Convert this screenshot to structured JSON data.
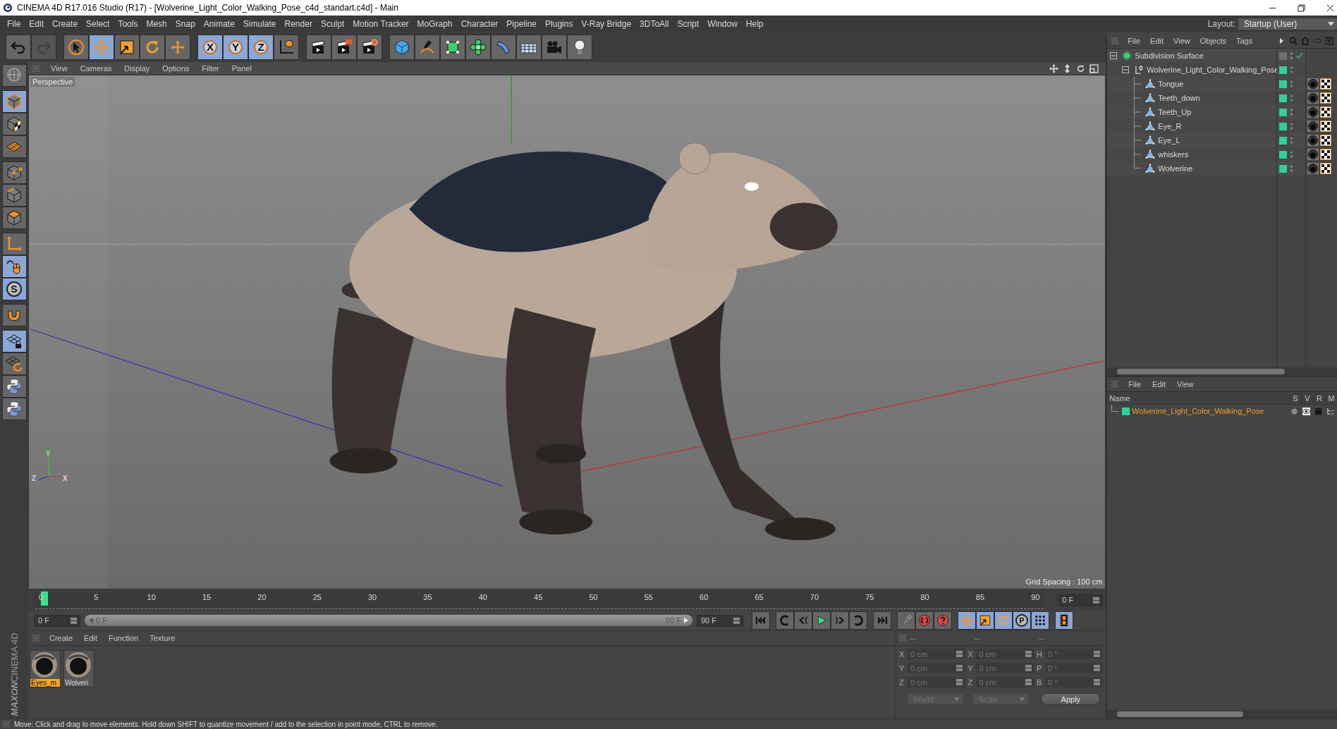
{
  "window": {
    "title": "CINEMA 4D R17.016 Studio (R17) - [Wolverine_Light_Color_Walking_Pose_c4d_standart.c4d] - Main"
  },
  "menu": [
    "File",
    "Edit",
    "Create",
    "Select",
    "Tools",
    "Mesh",
    "Snap",
    "Animate",
    "Simulate",
    "Render",
    "Sculpt",
    "Motion Tracker",
    "MoGraph",
    "Character",
    "Pipeline",
    "Plugins",
    "V-Ray Bridge",
    "3DToAll",
    "Script",
    "Window",
    "Help"
  ],
  "layout": {
    "label": "Layout:",
    "value": "Startup (User)"
  },
  "toolbar_groups": [
    [
      {
        "kind": "undo",
        "selected": false,
        "disabled": false
      },
      {
        "kind": "redo",
        "selected": false,
        "disabled": true
      }
    ],
    [
      {
        "kind": "select",
        "selected": false,
        "disabled": false
      },
      {
        "kind": "move",
        "selected": true,
        "disabled": false
      },
      {
        "kind": "scale",
        "selected": false,
        "disabled": false
      },
      {
        "kind": "rotate",
        "selected": false,
        "disabled": false
      },
      {
        "kind": "transform",
        "selected": false,
        "disabled": false
      }
    ],
    [
      {
        "kind": "axis",
        "label": "X",
        "selected": true,
        "disabled": false
      },
      {
        "kind": "axis",
        "label": "Y",
        "selected": true,
        "disabled": false
      },
      {
        "kind": "axis",
        "label": "Z",
        "selected": true,
        "disabled": false
      },
      {
        "kind": "coords",
        "selected": false,
        "disabled": false
      }
    ],
    [
      {
        "kind": "render_view",
        "selected": false,
        "disabled": false
      },
      {
        "kind": "render_picture",
        "selected": false,
        "disabled": false
      },
      {
        "kind": "render_settings",
        "selected": false,
        "disabled": false
      }
    ],
    [
      {
        "kind": "cube",
        "selected": false,
        "disabled": false
      },
      {
        "kind": "pen",
        "selected": false,
        "disabled": false
      },
      {
        "kind": "subdivision",
        "selected": false,
        "disabled": false
      },
      {
        "kind": "cloner",
        "selected": false,
        "disabled": false
      },
      {
        "kind": "deformer",
        "selected": false,
        "disabled": false
      },
      {
        "kind": "floor",
        "selected": false,
        "disabled": false
      },
      {
        "kind": "camera",
        "selected": false,
        "disabled": false
      },
      {
        "kind": "light",
        "selected": false,
        "disabled": false
      }
    ]
  ],
  "left_toolbar_groups": [
    [
      {
        "kind": "globe",
        "selected": false
      }
    ],
    [
      {
        "kind": "model",
        "selected": true
      },
      {
        "kind": "texture",
        "selected": false
      },
      {
        "kind": "workplane",
        "selected": false
      }
    ],
    [
      {
        "kind": "points",
        "selected": false
      },
      {
        "kind": "edges",
        "selected": false
      },
      {
        "kind": "polygons",
        "selected": false
      }
    ],
    [
      {
        "kind": "axis_mode",
        "selected": false
      },
      {
        "kind": "mouse",
        "selected": true
      },
      {
        "kind": "solo",
        "label": "S",
        "selected": true
      }
    ],
    [
      {
        "kind": "magnet",
        "selected": false
      }
    ],
    [
      {
        "kind": "grid_lock",
        "selected": true
      },
      {
        "kind": "grid_refresh",
        "selected": false
      },
      {
        "kind": "python",
        "selected": false
      },
      {
        "kind": "python",
        "selected": false
      }
    ]
  ],
  "viewport": {
    "menu": [
      "View",
      "Cameras",
      "Display",
      "Options",
      "Filter",
      "Panel"
    ],
    "camera_label": "Perspective",
    "grid_spacing": "Grid Spacing : 100 cm",
    "axis_labels": [
      "Y",
      "Z",
      "X"
    ]
  },
  "timeline": {
    "ticks": [
      "0",
      "5",
      "10",
      "15",
      "20",
      "25",
      "30",
      "35",
      "40",
      "45",
      "50",
      "55",
      "60",
      "65",
      "70",
      "75",
      "80",
      "85",
      "90"
    ],
    "playhead": {
      "level": 0
    },
    "current_frame": "0 F",
    "range_start": "0 F",
    "slider": {
      "start": "0 F",
      "end": "90 F",
      "level": 1
    },
    "range_end": "90 F"
  },
  "transport_groups": [
    [
      {
        "kind": "go_start",
        "selected": false
      }
    ],
    [
      {
        "kind": "prev_key",
        "selected": false
      },
      {
        "kind": "prev_frame",
        "selected": false
      },
      {
        "kind": "play",
        "selected": false
      },
      {
        "kind": "next_frame",
        "selected": false
      },
      {
        "kind": "next_key",
        "selected": false
      }
    ],
    [
      {
        "kind": "go_end",
        "selected": false
      }
    ],
    [
      {
        "kind": "key",
        "selected": false
      },
      {
        "kind": "record",
        "selected": false
      },
      {
        "kind": "help",
        "selected": false
      }
    ],
    [
      {
        "kind": "move",
        "selected": true
      },
      {
        "kind": "scale",
        "selected": true
      },
      {
        "kind": "rotate",
        "selected": true
      },
      {
        "kind": "param",
        "label": "P",
        "selected": true
      },
      {
        "kind": "dots",
        "selected": true
      }
    ],
    [
      {
        "kind": "film",
        "selected": true
      }
    ]
  ],
  "materials": {
    "menu": [
      "Create",
      "Edit",
      "Function",
      "Texture"
    ],
    "items": [
      {
        "name": "Eyes_m",
        "selected": true
      },
      {
        "name": "Wolveri",
        "selected": false
      }
    ]
  },
  "coordinates": {
    "headers": [
      "--",
      "--",
      "--"
    ],
    "rows": [
      {
        "axes": [
          "X",
          "X",
          "H"
        ],
        "values": [
          "0 cm",
          "0 cm",
          "0 °"
        ]
      },
      {
        "axes": [
          "Y",
          "Y",
          "P"
        ],
        "values": [
          "0 cm",
          "0 cm",
          "0 °"
        ]
      },
      {
        "axes": [
          "Z",
          "Z",
          "B"
        ],
        "values": [
          "0 cm",
          "0 cm",
          "0 °"
        ]
      }
    ],
    "dropdowns": [
      "World",
      "Scale"
    ],
    "apply": "Apply"
  },
  "objects": {
    "menu": [
      "File",
      "Edit",
      "View",
      "Objects",
      "Tags"
    ],
    "tree": [
      {
        "name": "Subdivision Surface",
        "kind": "subdivision",
        "layer": false,
        "expanded": true,
        "children": [
          {
            "name": "Wolverine_Light_Color_Walking_Pose",
            "kind": "null",
            "layer": true,
            "expanded": true,
            "children": [
              {
                "name": "Tongue",
                "kind": "polygon",
                "layer": true
              },
              {
                "name": "Teeth_down",
                "kind": "polygon",
                "layer": true
              },
              {
                "name": "Teeth_Up",
                "kind": "polygon",
                "layer": true
              },
              {
                "name": "Eye_R",
                "kind": "polygon",
                "layer": true
              },
              {
                "name": "Eye_L",
                "kind": "polygon",
                "layer": true
              },
              {
                "name": "whiskers",
                "kind": "polygon",
                "layer": true
              },
              {
                "name": "Wolverine",
                "kind": "polygon",
                "layer": true
              }
            ]
          }
        ]
      }
    ]
  },
  "layers": {
    "menu": [
      "File",
      "Edit",
      "View"
    ],
    "columns": [
      "Name",
      "S",
      "V",
      "R",
      "M"
    ],
    "rows": [
      {
        "name": "Wolverine_Light_Color_Walking_Pose",
        "color": "#2ed19a"
      }
    ]
  },
  "logo": {
    "brand": "MAXON",
    "product": "CINEMA 4D"
  },
  "status": "Move: Click and drag to move elements. Hold down SHIFT to quantize movement / add to the selection in point mode, CTRL to remove."
}
